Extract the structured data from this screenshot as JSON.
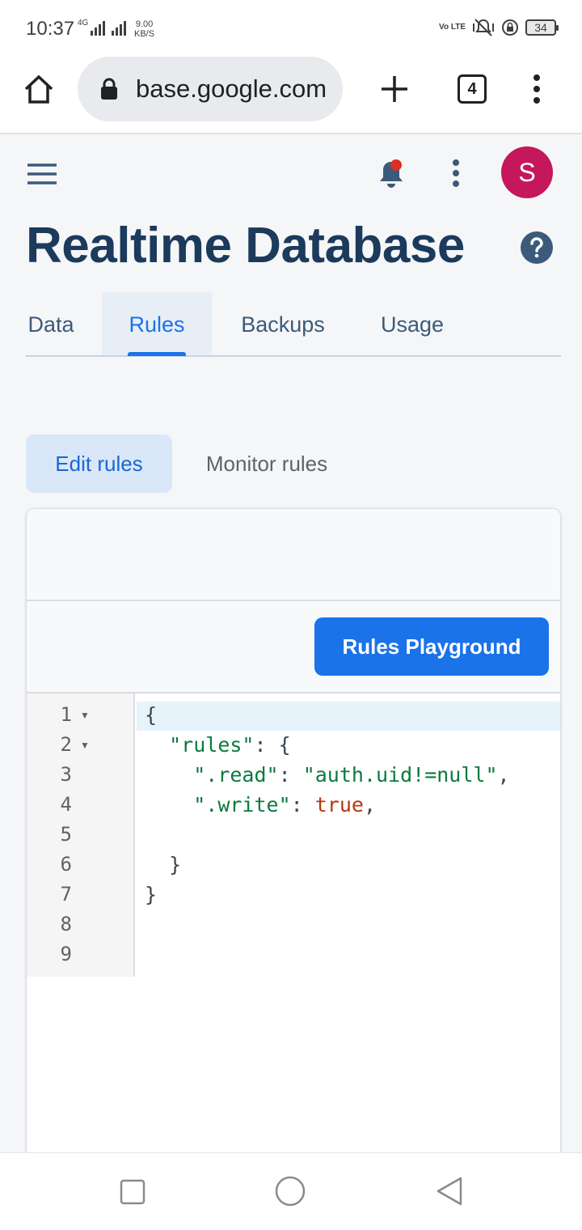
{
  "status_bar": {
    "time": "10:37",
    "network": "4G",
    "speed_value": "9.00",
    "speed_unit": "KB/S",
    "volte": "Vo LTE",
    "battery": "34"
  },
  "browser": {
    "url": "base.google.com",
    "tabs_count": "4"
  },
  "header": {
    "avatar_letter": "S",
    "notification_color": "#d93025"
  },
  "page": {
    "title": "Realtime Database"
  },
  "tabs": [
    {
      "label": "Data"
    },
    {
      "label": "Rules"
    },
    {
      "label": "Backups"
    },
    {
      "label": "Usage"
    }
  ],
  "active_tab": "Rules",
  "subtabs": {
    "edit": "Edit rules",
    "monitor": "Monitor rules"
  },
  "editor": {
    "playground_label": "Rules Playground",
    "line_numbers": [
      "1",
      "2",
      "3",
      "4",
      "5",
      "6",
      "7",
      "8",
      "9"
    ],
    "code": {
      "l1": "{",
      "l2_key": "\"rules\"",
      "l2_rest": ": {",
      "l3_key": "\".read\"",
      "l3_sep": ": ",
      "l3_val": "\"auth.uid!=null\"",
      "l3_end": ",",
      "l4_key": "\".write\"",
      "l4_sep": ": ",
      "l4_val": "true",
      "l4_end": ",",
      "l6": "}",
      "l7": "}"
    }
  },
  "colors": {
    "accent": "#1a73e8",
    "title": "#1b3a5c",
    "avatar": "#c5175b"
  }
}
